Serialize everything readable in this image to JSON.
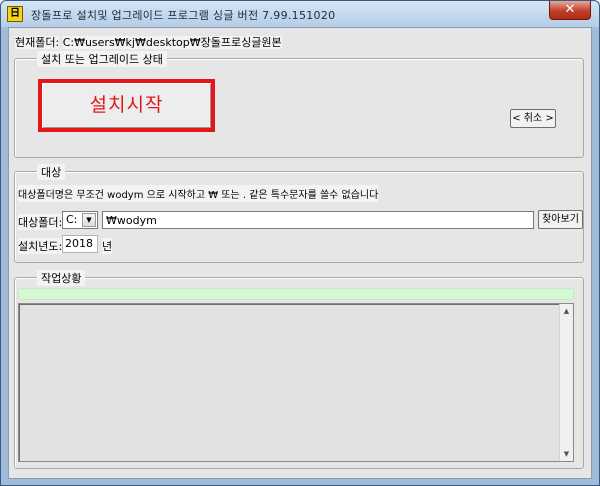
{
  "window": {
    "icon_text": "日",
    "title": "장돌프로 설치및 업그레이드 프로그램 싱글 버전  7.99.151020",
    "close_label": "✕"
  },
  "path": {
    "label": "현재폴더:",
    "value": "C:₩users₩kj₩desktop₩장돌프로싱글원본"
  },
  "install_group": {
    "legend": "설치 또는 업그레이드 상태",
    "start_label": "설치시작",
    "cancel_label": "< 취소 >"
  },
  "target_group": {
    "legend": "대상",
    "notice": "대상폴더명은 무조건 wodym 으로 시작하고  ₩ 또는  .  같은 특수문자를 쓸수 없습니다",
    "folder_label": "대상폴더:",
    "drive_value": "C:",
    "drive_arrow": "▼",
    "folder_value": "₩wodym",
    "browse_label": "찾아보기",
    "year_label": "설치년도:",
    "year_value": "2018",
    "year_unit": "년"
  },
  "progress_group": {
    "legend": "작업상황",
    "scroll_up": "▲",
    "scroll_down": "▼"
  },
  "colors": {
    "accent_red": "#e3161a",
    "progress_green": "#d4f7d4"
  }
}
